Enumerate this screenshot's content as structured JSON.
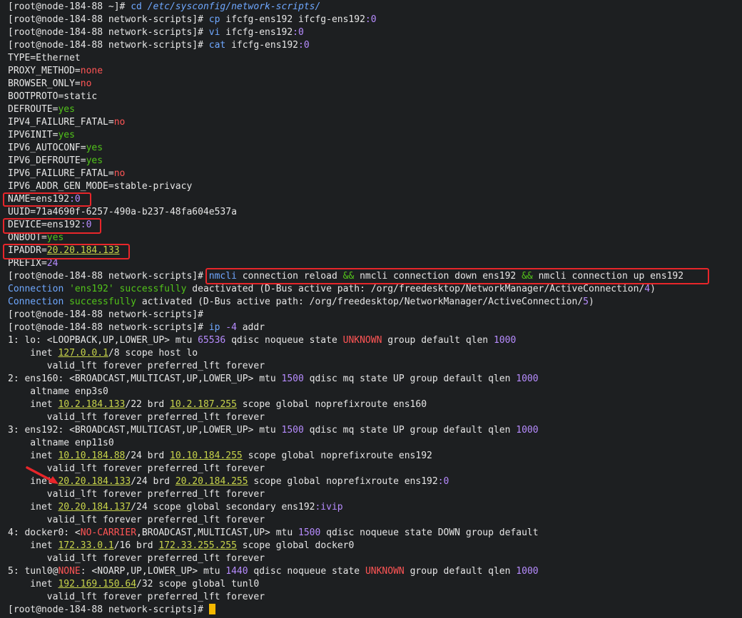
{
  "terminal": {
    "lines": [
      [
        [
          "[root@node-184-88 ~]# ",
          "c-prompt"
        ],
        [
          "cd ",
          "c-cmd"
        ],
        [
          "/etc/sysconfig/network-scripts/",
          "c-cmd c-italic"
        ]
      ],
      [
        [
          "[root@node-184-88 network-scripts]# ",
          "c-prompt"
        ],
        [
          "cp ",
          "c-cmd"
        ],
        [
          "ifcfg-ens192 ifcfg-ens192",
          ""
        ],
        [
          ":0",
          "c-purple"
        ]
      ],
      [
        [
          "[root@node-184-88 network-scripts]# ",
          "c-prompt"
        ],
        [
          "vi ",
          "c-cmd"
        ],
        [
          "ifcfg-ens192",
          ""
        ],
        [
          ":0",
          "c-purple"
        ]
      ],
      [
        [
          "[root@node-184-88 network-scripts]# ",
          "c-prompt"
        ],
        [
          "cat ",
          "c-cmd"
        ],
        [
          "ifcfg-ens192",
          ""
        ],
        [
          ":0",
          "c-purple"
        ]
      ],
      [
        [
          "TYPE=Ethernet",
          ""
        ]
      ],
      [
        [
          "PROXY_METHOD=",
          ""
        ],
        [
          "none",
          "c-red"
        ]
      ],
      [
        [
          "BROWSER_ONLY=",
          ""
        ],
        [
          "no",
          "c-red"
        ]
      ],
      [
        [
          "BOOTPROTO=static",
          ""
        ]
      ],
      [
        [
          "DEFROUTE=",
          ""
        ],
        [
          "yes",
          "c-green"
        ]
      ],
      [
        [
          "IPV4_FAILURE_FATAL=",
          ""
        ],
        [
          "no",
          "c-red"
        ]
      ],
      [
        [
          "IPV6INIT=",
          ""
        ],
        [
          "yes",
          "c-green"
        ]
      ],
      [
        [
          "IPV6_AUTOCONF=",
          ""
        ],
        [
          "yes",
          "c-green"
        ]
      ],
      [
        [
          "IPV6_DEFROUTE=",
          ""
        ],
        [
          "yes",
          "c-green"
        ]
      ],
      [
        [
          "IPV6_FAILURE_FATAL=",
          ""
        ],
        [
          "no",
          "c-red"
        ]
      ],
      [
        [
          "IPV6_ADDR_GEN_MODE=stable-privacy",
          ""
        ]
      ],
      [
        [
          "NAME=ens192",
          ""
        ],
        [
          ":0",
          "c-purple"
        ]
      ],
      [
        [
          "UUID=71a4690f-6257-490a-b237-48fa604e537a",
          ""
        ]
      ],
      [
        [
          "DEVICE=ens192",
          ""
        ],
        [
          ":0",
          "c-purple"
        ]
      ],
      [
        [
          "ONBOOT=",
          ""
        ],
        [
          "yes",
          "c-green"
        ]
      ],
      [
        [
          "IPADDR=",
          ""
        ],
        [
          "20.20.184.133",
          "c-yellow"
        ]
      ],
      [
        [
          "PREFIX=",
          ""
        ],
        [
          "24",
          "c-num"
        ]
      ],
      [
        [
          "[root@node-184-88 network-scripts]# ",
          "c-prompt"
        ],
        [
          "nmcli ",
          "c-cmd"
        ],
        [
          "connection reload ",
          ""
        ],
        [
          "&&",
          "c-green"
        ],
        [
          " nmcli connection down ens192 ",
          ""
        ],
        [
          "&&",
          "c-green"
        ],
        [
          " nmcli connection up ens192",
          ""
        ]
      ],
      [
        [
          "Connection ",
          "c-cmd"
        ],
        [
          "'ens192'",
          "c-green"
        ],
        [
          " ",
          ""
        ],
        [
          "successfully",
          "c-green"
        ],
        [
          " deactivated (D-Bus active path: /org/freedesktop/NetworkManager/ActiveConnection/",
          ""
        ],
        [
          "4",
          "c-num"
        ],
        [
          ")",
          ""
        ]
      ],
      [
        [
          "Connection ",
          "c-cmd"
        ],
        [
          "successfully",
          "c-green"
        ],
        [
          " activated (D-Bus active path: /org/freedesktop/NetworkManager/ActiveConnection/",
          ""
        ],
        [
          "5",
          "c-num"
        ],
        [
          ")",
          ""
        ]
      ],
      [
        [
          "[root@node-184-88 network-scripts]# ",
          "c-prompt"
        ]
      ],
      [
        [
          "[root@node-184-88 network-scripts]# ",
          "c-prompt"
        ],
        [
          "ip ",
          "c-cmd"
        ],
        [
          "-4 ",
          "c-purple"
        ],
        [
          "addr",
          ""
        ]
      ],
      [
        [
          "1",
          ""
        ],
        [
          ": lo: <LOOPBACK,UP,LOWER_UP> mtu ",
          ""
        ],
        [
          "65536",
          "c-num"
        ],
        [
          " qdisc noqueue state ",
          ""
        ],
        [
          "UNKNOWN",
          "c-red"
        ],
        [
          " group default qlen ",
          ""
        ],
        [
          "1000",
          "c-num"
        ]
      ],
      [
        [
          "    inet ",
          ""
        ],
        [
          "127.0.0.1",
          "c-yellow"
        ],
        [
          "/8 scope host lo",
          ""
        ]
      ],
      [
        [
          "       valid_lft forever preferred_lft forever",
          ""
        ]
      ],
      [
        [
          "2",
          ""
        ],
        [
          ": ens160: <BROADCAST,MULTICAST,UP,LOWER_UP> mtu ",
          ""
        ],
        [
          "1500",
          "c-num"
        ],
        [
          " qdisc mq state UP group default qlen ",
          ""
        ],
        [
          "1000",
          "c-num"
        ]
      ],
      [
        [
          "    altname enp3s0",
          ""
        ]
      ],
      [
        [
          "    inet ",
          ""
        ],
        [
          "10.2.184.133",
          "c-yellow"
        ],
        [
          "/22 brd ",
          ""
        ],
        [
          "10.2.187.255",
          "c-yellow"
        ],
        [
          " scope global noprefixroute ens160",
          ""
        ]
      ],
      [
        [
          "       valid_lft forever preferred_lft forever",
          ""
        ]
      ],
      [
        [
          "3",
          ""
        ],
        [
          ": ens192: <BROADCAST,MULTICAST,UP,LOWER_UP> mtu ",
          ""
        ],
        [
          "1500",
          "c-num"
        ],
        [
          " qdisc mq state UP group default qlen ",
          ""
        ],
        [
          "1000",
          "c-num"
        ]
      ],
      [
        [
          "    altname enp11s0",
          ""
        ]
      ],
      [
        [
          "    inet ",
          ""
        ],
        [
          "10.10.184.88",
          "c-yellow"
        ],
        [
          "/24 brd ",
          ""
        ],
        [
          "10.10.184.255",
          "c-yellow"
        ],
        [
          " scope global noprefixroute ens192",
          ""
        ]
      ],
      [
        [
          "       valid_lft forever preferred_lft forever",
          ""
        ]
      ],
      [
        [
          "    inet ",
          ""
        ],
        [
          "20.20.184.133",
          "c-yellow"
        ],
        [
          "/24 brd ",
          ""
        ],
        [
          "20.20.184.255",
          "c-yellow"
        ],
        [
          " scope global noprefixroute ens192",
          ""
        ],
        [
          ":0",
          "c-purple"
        ]
      ],
      [
        [
          "       valid_lft forever preferred_lft forever",
          ""
        ]
      ],
      [
        [
          "    inet ",
          ""
        ],
        [
          "20.20.184.137",
          "c-yellow"
        ],
        [
          "/24 scope global secondary ens192",
          ""
        ],
        [
          ":ivip",
          "c-purple"
        ]
      ],
      [
        [
          "       valid_lft forever preferred_lft forever",
          ""
        ]
      ],
      [
        [
          "4",
          ""
        ],
        [
          ": docker0: <",
          ""
        ],
        [
          "NO-CARRIER",
          "c-red"
        ],
        [
          ",BROADCAST,MULTICAST,UP> mtu ",
          ""
        ],
        [
          "1500",
          "c-num"
        ],
        [
          " qdisc noqueue state DOWN group default",
          ""
        ]
      ],
      [
        [
          "    inet ",
          ""
        ],
        [
          "172.33.0.1",
          "c-yellow"
        ],
        [
          "/16 brd ",
          ""
        ],
        [
          "172.33.255.255",
          "c-yellow"
        ],
        [
          " scope global docker0",
          ""
        ]
      ],
      [
        [
          "       valid_lft forever preferred_lft forever",
          ""
        ]
      ],
      [
        [
          "5",
          ""
        ],
        [
          ": tunl0@",
          ""
        ],
        [
          "NONE",
          "c-red"
        ],
        [
          ": <NOARP,UP,LOWER_UP> mtu ",
          ""
        ],
        [
          "1440",
          "c-num"
        ],
        [
          " qdisc noqueue state ",
          ""
        ],
        [
          "UNKNOWN",
          "c-red"
        ],
        [
          " group default qlen ",
          ""
        ],
        [
          "1000",
          "c-num"
        ]
      ],
      [
        [
          "    inet ",
          ""
        ],
        [
          "192.169.150.64",
          "c-yellow"
        ],
        [
          "/32 scope global tunl0",
          ""
        ]
      ],
      [
        [
          "       valid_lft forever preferred_lft forever",
          ""
        ]
      ],
      [
        [
          "[root@node-184-88 network-scripts]# ",
          "c-prompt"
        ]
      ]
    ]
  },
  "colors": {
    "background": "#1d1f21",
    "annotation_red": "#e8262a",
    "cursor": "#f5b800"
  }
}
